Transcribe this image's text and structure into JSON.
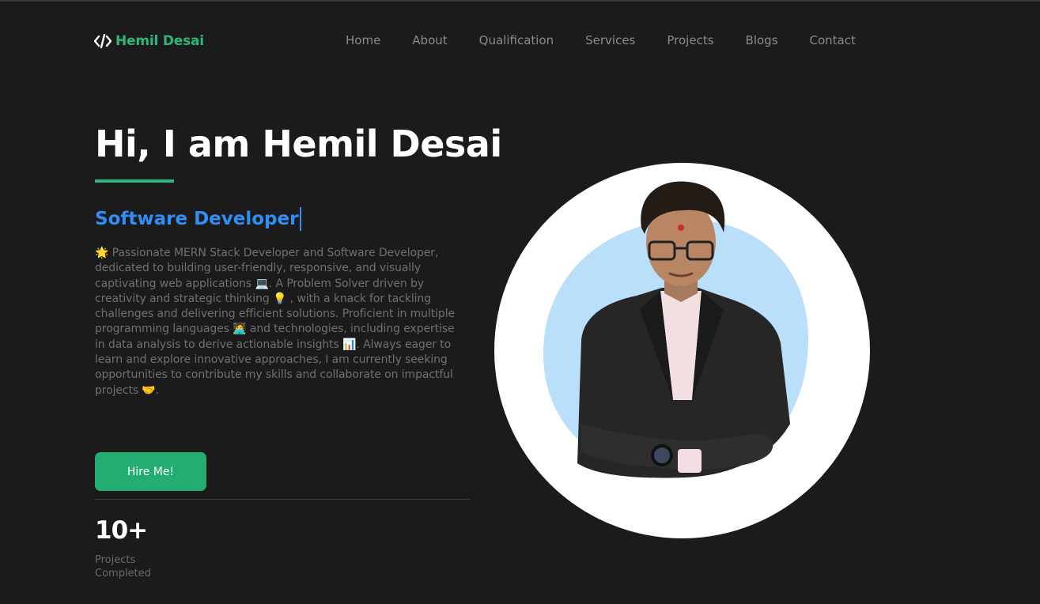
{
  "header": {
    "logo_icon": "code-brackets-icon",
    "logo_text": "Hemil Desai",
    "brand_color": "#2eb67d",
    "nav": [
      {
        "label": "Home"
      },
      {
        "label": "About"
      },
      {
        "label": "Qualification"
      },
      {
        "label": "Services"
      },
      {
        "label": "Projects"
      },
      {
        "label": "Blogs"
      },
      {
        "label": "Contact"
      }
    ]
  },
  "hero": {
    "title": "Hi, I am Hemil Desai",
    "role": "Software Developer",
    "role_color": "#2f8ff5",
    "bio": "🌟 Passionate MERN Stack Developer and Software Developer, dedicated to building user-friendly, responsive, and visually captivating web applications 💻. A Problem Solver driven by creativity and strategic thinking 💡 , with a knack for tackling challenges and delivering efficient solutions. Proficient in multiple programming languages 🧑‍💻 and technologies, including expertise in data analysis to derive actionable insights 📊. Always eager to learn and explore innovative approaches, I am currently seeking opportunities to contribute my skills and collaborate on impactful projects 🤝.",
    "cta_label": "Hire Me!",
    "cta_color": "#24ad73"
  },
  "stats": {
    "value": "10+",
    "label": "Projects Completed"
  },
  "portrait": {
    "description_icon": "profile-photo",
    "blob_color": "#b9dffb"
  }
}
